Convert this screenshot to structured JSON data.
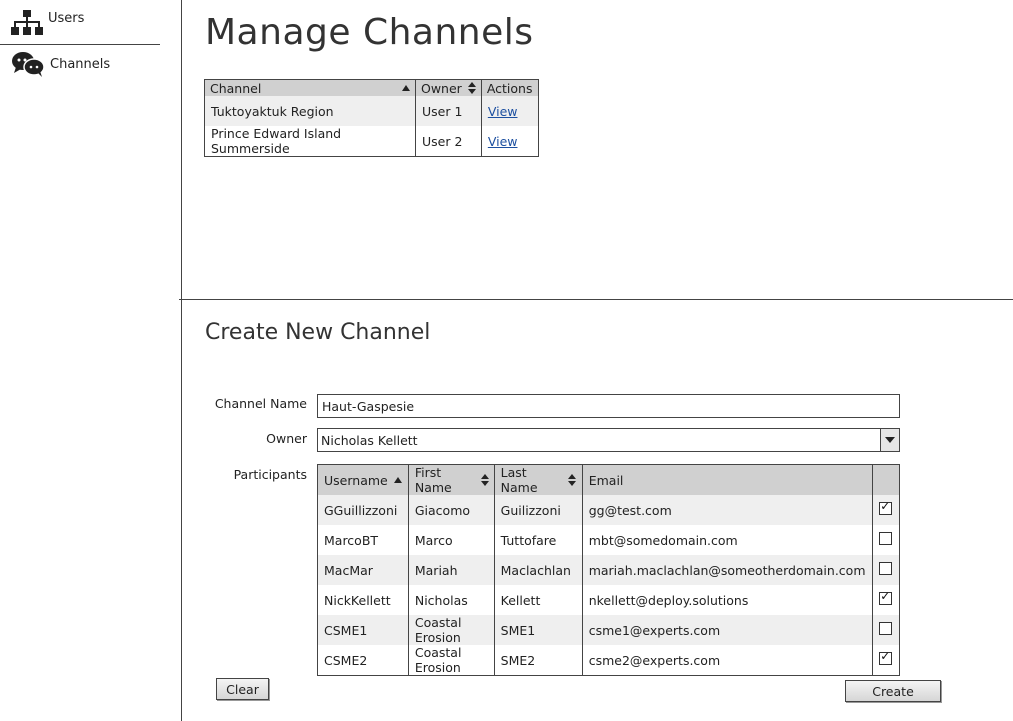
{
  "sidebar": {
    "items": [
      {
        "label": "Users",
        "icon": "org-chart-icon"
      },
      {
        "label": "Channels",
        "icon": "chat-bubbles-icon"
      }
    ]
  },
  "manage": {
    "title": "Manage Channels",
    "columns": [
      "Channel",
      "Owner",
      "Actions"
    ],
    "rows": [
      {
        "channel": "Tuktoyaktuk Region",
        "owner": "User 1",
        "action": "View"
      },
      {
        "channel": "Prince Edward Island Summerside",
        "owner": "User 2",
        "action": "View"
      }
    ]
  },
  "create": {
    "title": "Create New Channel",
    "channel_name_label": "Channel Name",
    "channel_name_value": "Haut-Gaspesie",
    "owner_label": "Owner",
    "owner_value": "Nicholas Kellett",
    "participants_label": "Participants",
    "participant_columns": [
      "Username",
      "First Name",
      "Last Name",
      "Email"
    ],
    "participants": [
      {
        "username": "GGuillizzoni",
        "first": "Giacomo",
        "last": "Guilizzoni",
        "email": "gg@test.com",
        "checked": true
      },
      {
        "username": "MarcoBT",
        "first": "Marco",
        "last": "Tuttofare",
        "email": "mbt@somedomain.com",
        "checked": false
      },
      {
        "username": "MacMar",
        "first": "Mariah",
        "last": "Maclachlan",
        "email": "mariah.maclachlan@someotherdomain.com",
        "checked": false
      },
      {
        "username": "NickKellett",
        "first": "Nicholas",
        "last": "Kellett",
        "email": "nkellett@deploy.solutions",
        "checked": true
      },
      {
        "username": "CSME1",
        "first": "Coastal Erosion",
        "last": "SME1",
        "email": "csme1@experts.com",
        "checked": false
      },
      {
        "username": "CSME2",
        "first": "Coastal Erosion",
        "last": "SME2",
        "email": "csme2@experts.com",
        "checked": true
      }
    ],
    "clear_label": "Clear",
    "create_label": "Create"
  }
}
